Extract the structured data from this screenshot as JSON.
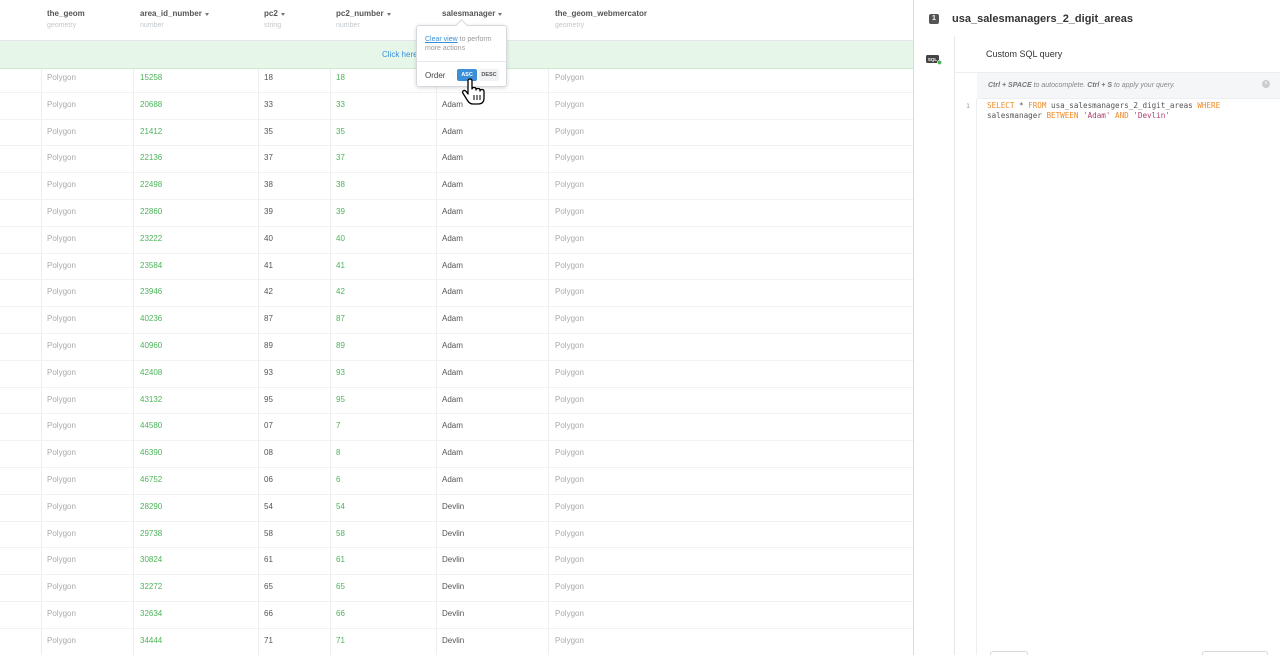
{
  "table": {
    "columns": [
      {
        "name": "the_geom",
        "type": "geometry",
        "sortable": false
      },
      {
        "name": "area_id_number",
        "type": "number",
        "sortable": true
      },
      {
        "name": "pc2",
        "type": "string",
        "sortable": true
      },
      {
        "name": "pc2_number",
        "type": "number",
        "sortable": true
      },
      {
        "name": "salesmanager",
        "type": "",
        "sortable": true
      },
      {
        "name": "the_geom_webmercator",
        "type": "geometry",
        "sortable": false
      }
    ],
    "notice": "Click here",
    "rows": [
      [
        "Polygon",
        "15258",
        "18",
        "18",
        "",
        "Polygon"
      ],
      [
        "Polygon",
        "20688",
        "33",
        "33",
        "Adam",
        "Polygon"
      ],
      [
        "Polygon",
        "21412",
        "35",
        "35",
        "Adam",
        "Polygon"
      ],
      [
        "Polygon",
        "22136",
        "37",
        "37",
        "Adam",
        "Polygon"
      ],
      [
        "Polygon",
        "22498",
        "38",
        "38",
        "Adam",
        "Polygon"
      ],
      [
        "Polygon",
        "22860",
        "39",
        "39",
        "Adam",
        "Polygon"
      ],
      [
        "Polygon",
        "23222",
        "40",
        "40",
        "Adam",
        "Polygon"
      ],
      [
        "Polygon",
        "23584",
        "41",
        "41",
        "Adam",
        "Polygon"
      ],
      [
        "Polygon",
        "23946",
        "42",
        "42",
        "Adam",
        "Polygon"
      ],
      [
        "Polygon",
        "40236",
        "87",
        "87",
        "Adam",
        "Polygon"
      ],
      [
        "Polygon",
        "40960",
        "89",
        "89",
        "Adam",
        "Polygon"
      ],
      [
        "Polygon",
        "42408",
        "93",
        "93",
        "Adam",
        "Polygon"
      ],
      [
        "Polygon",
        "43132",
        "95",
        "95",
        "Adam",
        "Polygon"
      ],
      [
        "Polygon",
        "44580",
        "07",
        "7",
        "Adam",
        "Polygon"
      ],
      [
        "Polygon",
        "46390",
        "08",
        "8",
        "Adam",
        "Polygon"
      ],
      [
        "Polygon",
        "46752",
        "06",
        "6",
        "Adam",
        "Polygon"
      ],
      [
        "Polygon",
        "28290",
        "54",
        "54",
        "Devlin",
        "Polygon"
      ],
      [
        "Polygon",
        "29738",
        "58",
        "58",
        "Devlin",
        "Polygon"
      ],
      [
        "Polygon",
        "30824",
        "61",
        "61",
        "Devlin",
        "Polygon"
      ],
      [
        "Polygon",
        "32272",
        "65",
        "65",
        "Devlin",
        "Polygon"
      ],
      [
        "Polygon",
        "32634",
        "66",
        "66",
        "Devlin",
        "Polygon"
      ],
      [
        "Polygon",
        "34444",
        "71",
        "71",
        "Devlin",
        "Polygon"
      ]
    ]
  },
  "popup": {
    "clear_view": "Clear view",
    "message_rest": " to perform more actions",
    "order_label": "Order",
    "asc": "ASC",
    "desc": "DESC",
    "selected": "ASC"
  },
  "panel": {
    "layer_number": "1",
    "layer_title": "usa_salesmanagers_2_digit_areas",
    "sql_icon": "sql-icon",
    "card_title": "Custom SQL query",
    "hint_ctrl_space": "Ctrl + SPACE",
    "hint_mid": " to autocomplete. ",
    "hint_ctrl_s": "Ctrl + S",
    "hint_end": " to apply your query.",
    "line_number": "1",
    "sql": {
      "select": "SELECT",
      "star": " * ",
      "from": "FROM",
      "table": " usa_salesmanagers_2_digit_areas ",
      "where": "WHERE",
      "column": "salesmanager ",
      "between": "BETWEEN",
      "v1": " 'Adam' ",
      "and": "AND",
      "v2": " 'Devlin'"
    }
  },
  "colors": {
    "accent": "#3a8fd8",
    "number_green": "#4cb45a",
    "notice_bg": "#e6f7ea",
    "sql_keyword": "#f08a24"
  }
}
